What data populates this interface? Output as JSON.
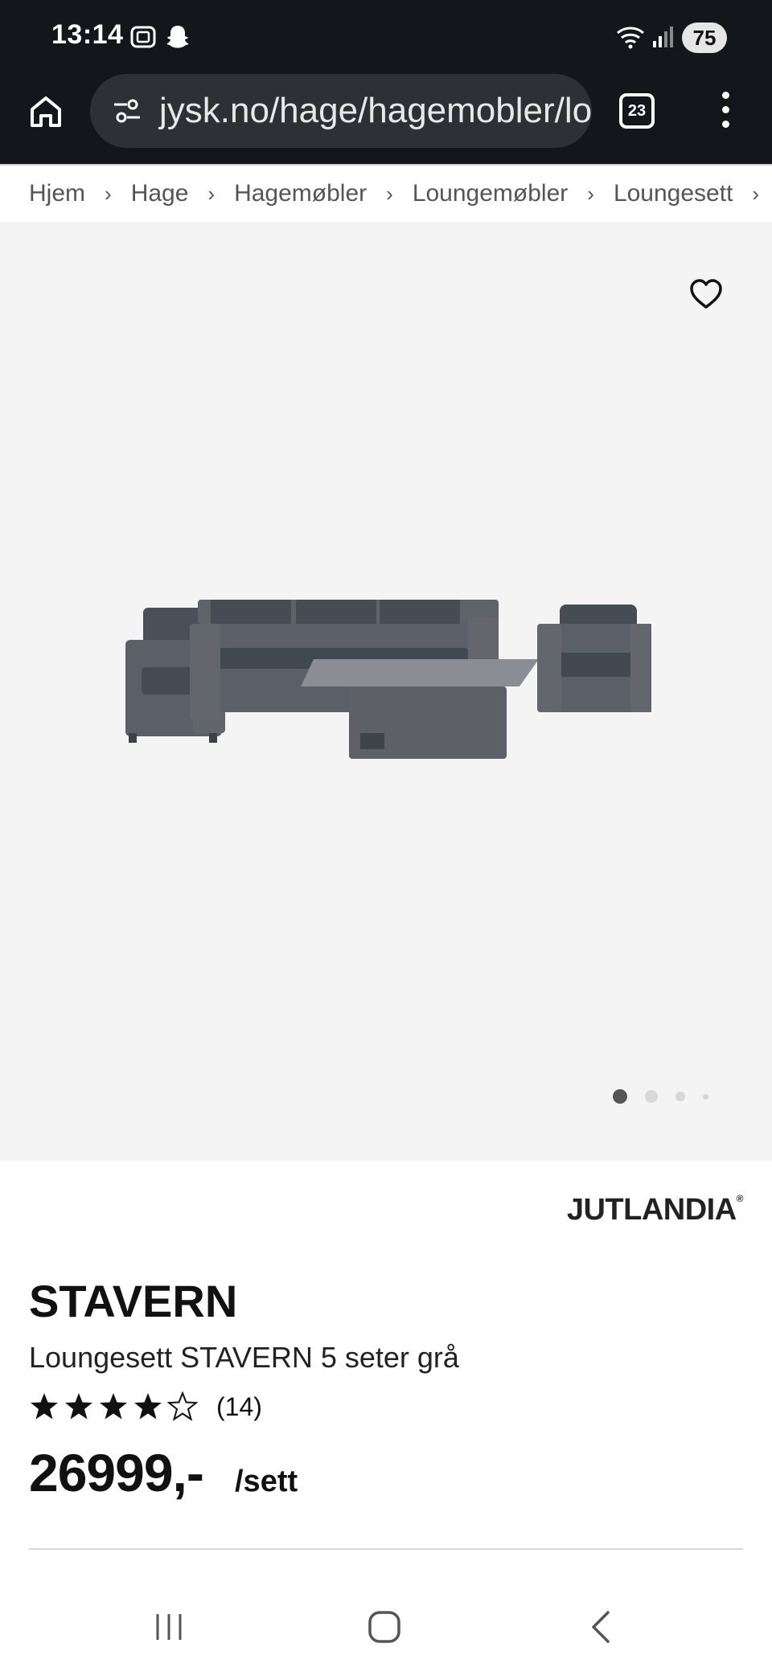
{
  "status_bar": {
    "time": "13:14",
    "battery": "75"
  },
  "browser": {
    "url": "jysk.no/hage/hagemobler/loungemobler",
    "tab_count": "23"
  },
  "breadcrumb": [
    "Hjem",
    "Hage",
    "Hagemøbler",
    "Loungemøbler",
    "Loungesett"
  ],
  "breadcrumb_separator": "›",
  "gallery": {
    "image_count": 4,
    "active_index": 0
  },
  "product": {
    "brand": "JUTLANDIA",
    "brand_mark": "®",
    "title": "STAVERN",
    "subtitle": "Loungesett STAVERN 5 seter grå",
    "rating": 4,
    "rating_max": 5,
    "review_count": "(14)",
    "price": "26999,-",
    "unit": "/sett"
  },
  "colors": {
    "status_bar_bg": "#14161c",
    "url_pill_bg": "#2e3036",
    "gallery_bg": "#f4f4f4",
    "text": "#111111"
  },
  "icons": [
    "home-icon",
    "site-settings-icon",
    "tabs-icon",
    "more-icon",
    "heart-icon",
    "star-icon",
    "recent-apps-icon",
    "home-nav-icon",
    "back-icon"
  ]
}
